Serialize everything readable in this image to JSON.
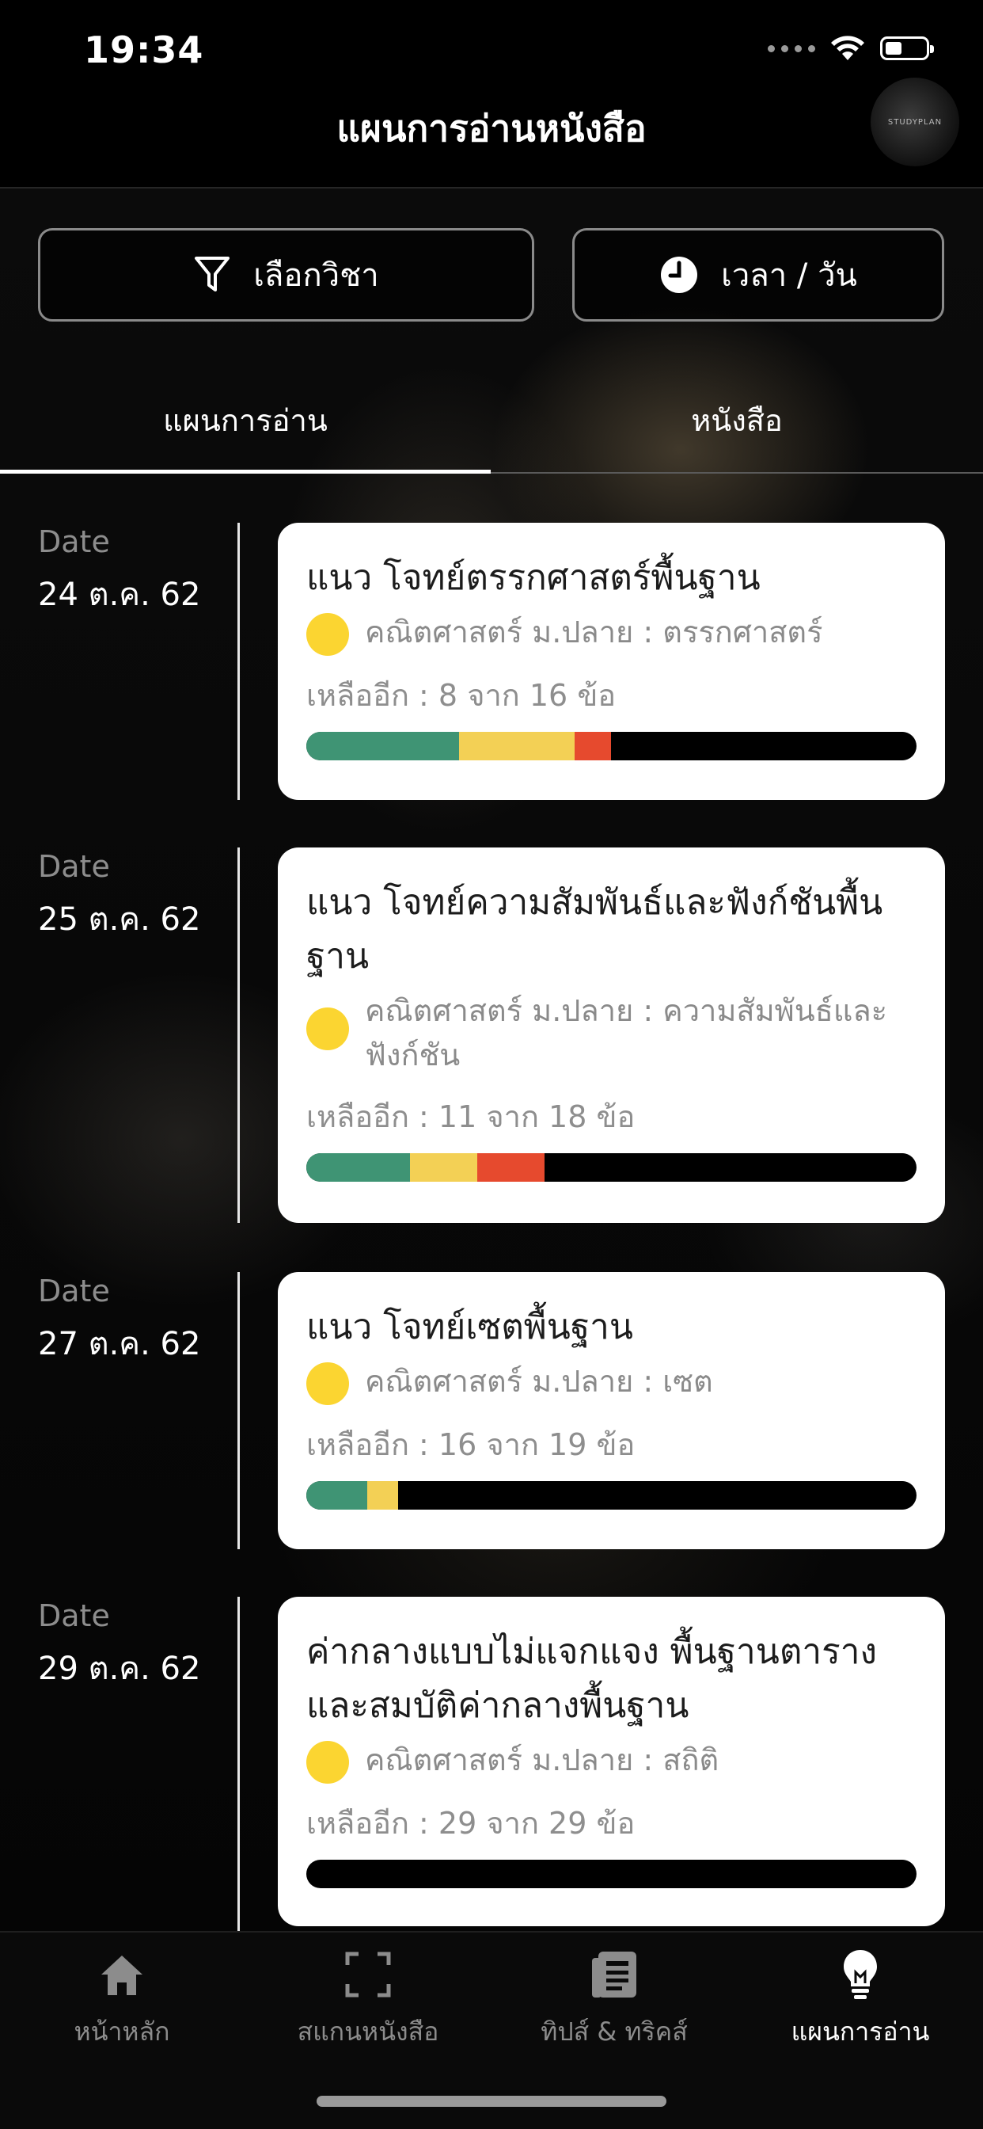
{
  "status_bar": {
    "time": "19:34"
  },
  "header": {
    "title": "แผนการอ่านหนังสือ",
    "logo_text": "STUDYPLAN"
  },
  "filters": [
    {
      "label": "เลือกวิชา",
      "icon": "filter-icon"
    },
    {
      "label": "เวลา / วัน",
      "icon": "clock-icon"
    }
  ],
  "tabs": [
    {
      "label": "แผนการอ่าน",
      "active": true
    },
    {
      "label": "หนังสือ",
      "active": false
    }
  ],
  "date_label": "Date",
  "colors": {
    "green": "#3f9474",
    "yellow": "#f3d055",
    "red": "#e64a2e",
    "dot": "#fbd531"
  },
  "plans": [
    {
      "date": "24 ต.ค. 62",
      "title": "แนว โจทย์ตรรกศาสตร์พื้นฐาน",
      "subject": "คณิตศาสตร์ ม.ปลาย : ตรรกศาสตร์",
      "remaining": "เหลืออีก : 8 จาก 16 ข้อ",
      "progress": {
        "green": 0.25,
        "yellow": 0.19,
        "red": 0.06
      }
    },
    {
      "date": "25 ต.ค. 62",
      "title": "แนว โจทย์ความสัมพันธ์และฟังก์ชันพื้นฐาน",
      "subject": "คณิตศาสตร์ ม.ปลาย : ความสัมพันธ์และฟังก์ชัน",
      "remaining": "เหลืออีก : 11 จาก 18 ข้อ",
      "progress": {
        "green": 0.17,
        "yellow": 0.11,
        "red": 0.11
      }
    },
    {
      "date": "27 ต.ค. 62",
      "title": "แนว โจทย์เซตพื้นฐาน",
      "subject": "คณิตศาสตร์ ม.ปลาย : เซต",
      "remaining": "เหลืออีก : 16 จาก 19 ข้อ",
      "progress": {
        "green": 0.1,
        "yellow": 0.05,
        "red": 0
      }
    },
    {
      "date": "29 ต.ค. 62",
      "title": "ค่ากลางแบบไม่แจกแจง พื้นฐานตาราง และสมบัติค่ากลางพื้นฐาน",
      "subject": "คณิตศาสตร์ ม.ปลาย : สถิติ",
      "remaining": "เหลืออีก : 29 จาก 29 ข้อ",
      "progress": {
        "green": 0,
        "yellow": 0,
        "red": 0
      }
    }
  ],
  "tabbar": [
    {
      "label": "หน้าหลัก",
      "icon": "home-icon",
      "active": false
    },
    {
      "label": "สแกนหนังสือ",
      "icon": "scan-icon",
      "active": false
    },
    {
      "label": "ทิปส์ & ทริคส์",
      "icon": "article-icon",
      "active": false
    },
    {
      "label": "แผนการอ่าน",
      "icon": "lightbulb-icon",
      "active": true
    }
  ]
}
